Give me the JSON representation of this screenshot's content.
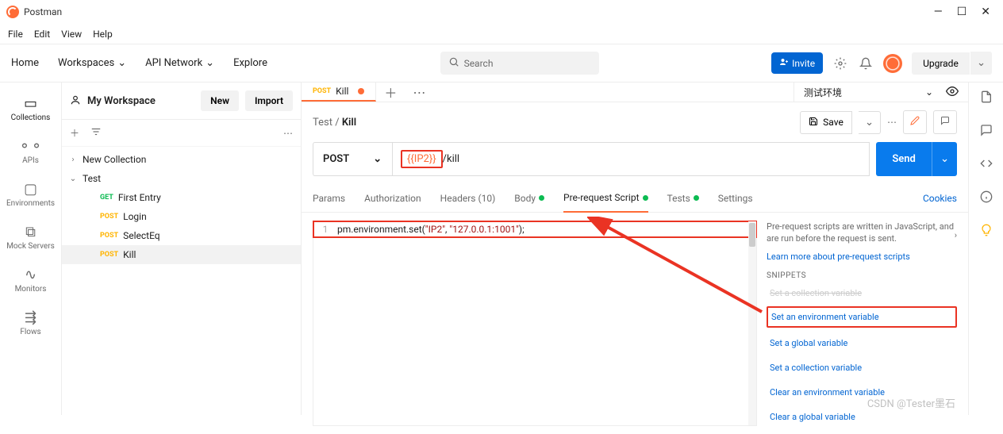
{
  "app": {
    "title": "Postman"
  },
  "window": {
    "min": "—",
    "max": "☐",
    "close": "✕"
  },
  "menu": {
    "file": "File",
    "edit": "Edit",
    "view": "View",
    "help": "Help"
  },
  "nav": {
    "home": "Home",
    "workspaces": "Workspaces",
    "apinet": "API Network",
    "explore": "Explore",
    "search_ph": "Search",
    "invite": "Invite",
    "upgrade": "Upgrade"
  },
  "rail": {
    "collections": "Collections",
    "apis": "APIs",
    "env": "Environments",
    "mock": "Mock Servers",
    "monitors": "Monitors",
    "flows": "Flows"
  },
  "workspace": {
    "name": "My Workspace",
    "new": "New",
    "import": "Import"
  },
  "tree": {
    "c1": "New Collection",
    "c2": "Test",
    "items": [
      {
        "method": "GET",
        "name": "First Entry"
      },
      {
        "method": "POST",
        "name": "Login"
      },
      {
        "method": "POST",
        "name": "SelectEq"
      },
      {
        "method": "POST",
        "name": "Kill"
      }
    ]
  },
  "tab": {
    "method": "POST",
    "name": "Kill"
  },
  "env": {
    "name": "测试环境"
  },
  "crumb": {
    "parent": "Test",
    "name": "Kill"
  },
  "actions": {
    "save": "Save"
  },
  "request": {
    "method": "POST",
    "url_var": "{{IP2}}",
    "url_rest": "/kill",
    "send": "Send"
  },
  "rtabs": {
    "params": "Params",
    "auth": "Authorization",
    "headers": "Headers (10)",
    "body": "Body",
    "pre": "Pre-request Script",
    "tests": "Tests",
    "settings": "Settings",
    "cookies": "Cookies"
  },
  "code": {
    "line1_no": "1",
    "line1": "pm.environment.set(\"IP2\", \"127.0.0.1:1001\");"
  },
  "snippets": {
    "desc": "Pre-request scripts are written in JavaScript, and are run before the request is sent.",
    "learn": "Learn more about pre-request scripts",
    "head": "SNIPPETS",
    "s_trunc": "Set a collection variable",
    "s1": "Set an environment variable",
    "s2": "Set a global variable",
    "s3": "Set a collection variable",
    "s4": "Clear an environment variable",
    "s5": "Clear a global variable"
  },
  "watermark": "CSDN @Tester墨石"
}
